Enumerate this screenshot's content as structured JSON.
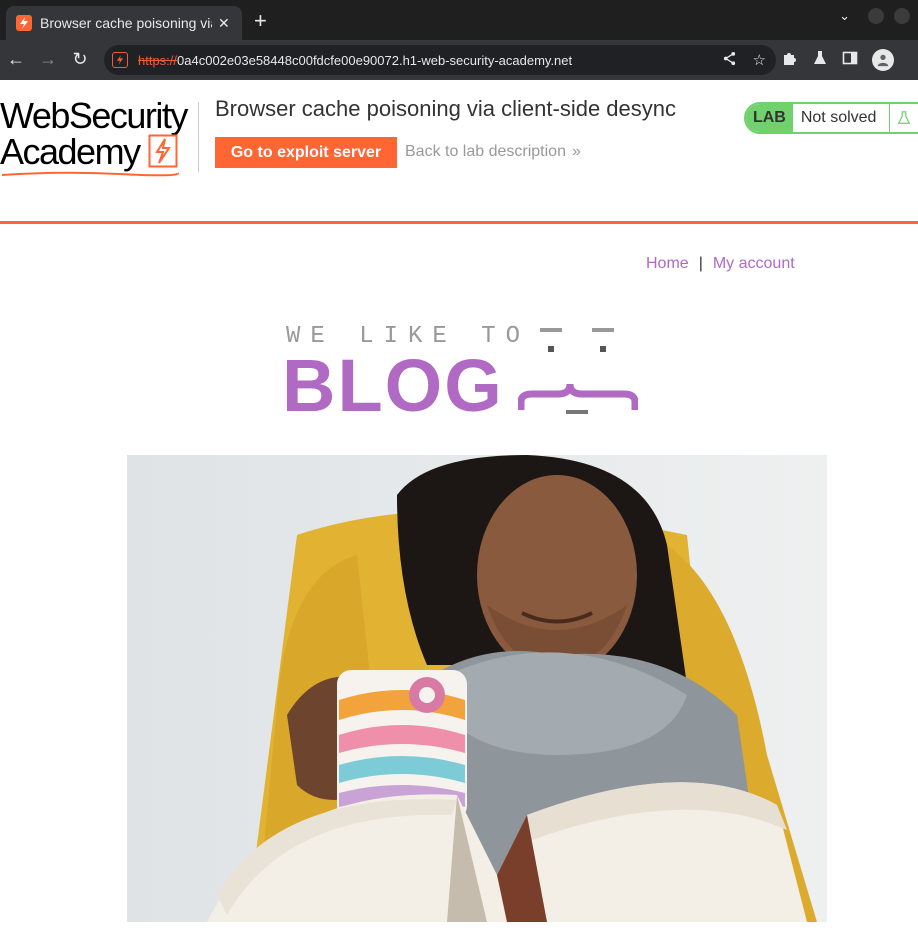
{
  "browser": {
    "tab_title": "Browser cache poisoning via client-side desync",
    "tab_close": "✕",
    "new_tab": "+",
    "url_scheme": "https://",
    "url_rest": "0a4c002e03e58448c00fdcfe00e90072.h1-web-security-academy.net"
  },
  "lab": {
    "logo_line1": "WebSecurity",
    "logo_line2": "Academy",
    "title": "Browser cache poisoning via client-side desync",
    "exploit_button": "Go to exploit server",
    "back_link": "Back to lab description",
    "status_tag": "LAB",
    "status_text": "Not solved"
  },
  "blog": {
    "nav_home": "Home",
    "nav_separator": "|",
    "nav_account": "My account",
    "banner_small": "WE LIKE TO",
    "banner_big": "BLOG"
  },
  "colors": {
    "accent": "#ff6633",
    "blog_purple": "#b06ac4",
    "status_green": "#70d16d"
  }
}
